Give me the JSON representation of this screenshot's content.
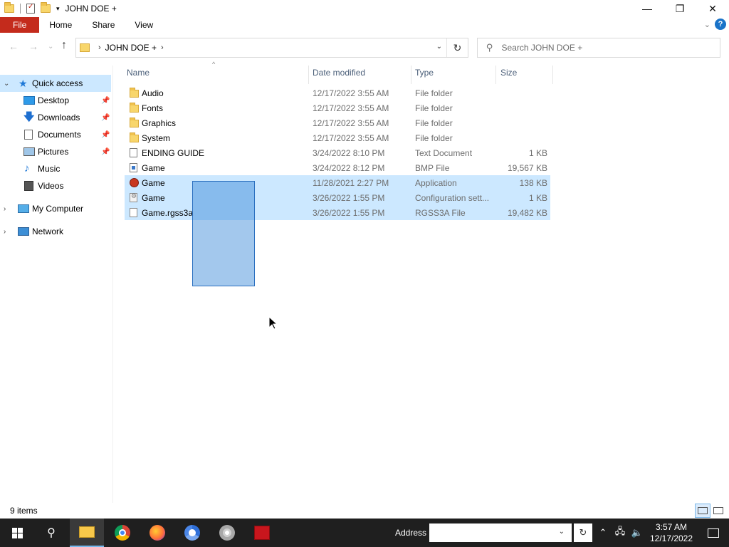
{
  "window": {
    "title": "JOHN DOE +",
    "controls": {
      "minimize": "—",
      "maximize": "❐",
      "close": "✕"
    }
  },
  "ribbon": {
    "tabs": [
      "File",
      "Home",
      "Share",
      "View"
    ],
    "help": "?"
  },
  "address_bar": {
    "breadcrumb": [
      "JOHN DOE +"
    ],
    "search_placeholder": "Search JOHN DOE +"
  },
  "nav_pane": {
    "items": [
      {
        "label": "Quick access",
        "icon": "star-icon",
        "selected": true
      },
      {
        "label": "Desktop",
        "icon": "desktop-icon",
        "pinned": true
      },
      {
        "label": "Downloads",
        "icon": "download-icon",
        "pinned": true
      },
      {
        "label": "Documents",
        "icon": "documents-icon",
        "pinned": true
      },
      {
        "label": "Pictures",
        "icon": "pictures-icon",
        "pinned": true
      },
      {
        "label": "Music",
        "icon": "music-icon"
      },
      {
        "label": "Videos",
        "icon": "videos-icon"
      },
      {
        "label": "My Computer",
        "icon": "computer-icon"
      },
      {
        "label": "Network",
        "icon": "network-icon"
      }
    ]
  },
  "file_list": {
    "columns": [
      "Name",
      "Date modified",
      "Type",
      "Size"
    ],
    "rows": [
      {
        "name": "Audio",
        "date": "12/17/2022 3:55 AM",
        "type": "File folder",
        "size": "",
        "icon": "folder-icon",
        "selected": false
      },
      {
        "name": "Fonts",
        "date": "12/17/2022 3:55 AM",
        "type": "File folder",
        "size": "",
        "icon": "folder-icon",
        "selected": false
      },
      {
        "name": "Graphics",
        "date": "12/17/2022 3:55 AM",
        "type": "File folder",
        "size": "",
        "icon": "folder-icon",
        "selected": false
      },
      {
        "name": "System",
        "date": "12/17/2022 3:55 AM",
        "type": "File folder",
        "size": "",
        "icon": "folder-icon",
        "selected": false
      },
      {
        "name": "ENDING GUIDE",
        "date": "3/24/2022 8:10 PM",
        "type": "Text Document",
        "size": "1 KB",
        "icon": "text-file-icon",
        "selected": false
      },
      {
        "name": "Game",
        "date": "3/24/2022 8:12 PM",
        "type": "BMP File",
        "size": "19,567 KB",
        "icon": "bmp-file-icon",
        "selected": false
      },
      {
        "name": "Game",
        "date": "11/28/2021 2:27 PM",
        "type": "Application",
        "size": "138 KB",
        "icon": "application-icon",
        "selected": true
      },
      {
        "name": "Game",
        "date": "3/26/2022 1:55 PM",
        "type": "Configuration sett...",
        "size": "1 KB",
        "icon": "config-file-icon",
        "selected": true
      },
      {
        "name": "Game.rgss3a",
        "date": "3/26/2022 1:55 PM",
        "type": "RGSS3A File",
        "size": "19,482 KB",
        "icon": "generic-file-icon",
        "selected": true
      }
    ]
  },
  "status_bar": {
    "item_count": "9 items"
  },
  "taskbar": {
    "address_label": "Address",
    "clock_time": "3:57 AM",
    "clock_date": "12/17/2022",
    "apps": [
      "file-explorer-icon",
      "chrome-icon",
      "firefox-icon",
      "chromium-icon",
      "disc-icon",
      "game-icon"
    ]
  },
  "colors": {
    "file_tab": "#c42b1c",
    "selection": "#cce8ff",
    "marquee": "#3385d6",
    "taskbar": "#1f1f1f"
  }
}
